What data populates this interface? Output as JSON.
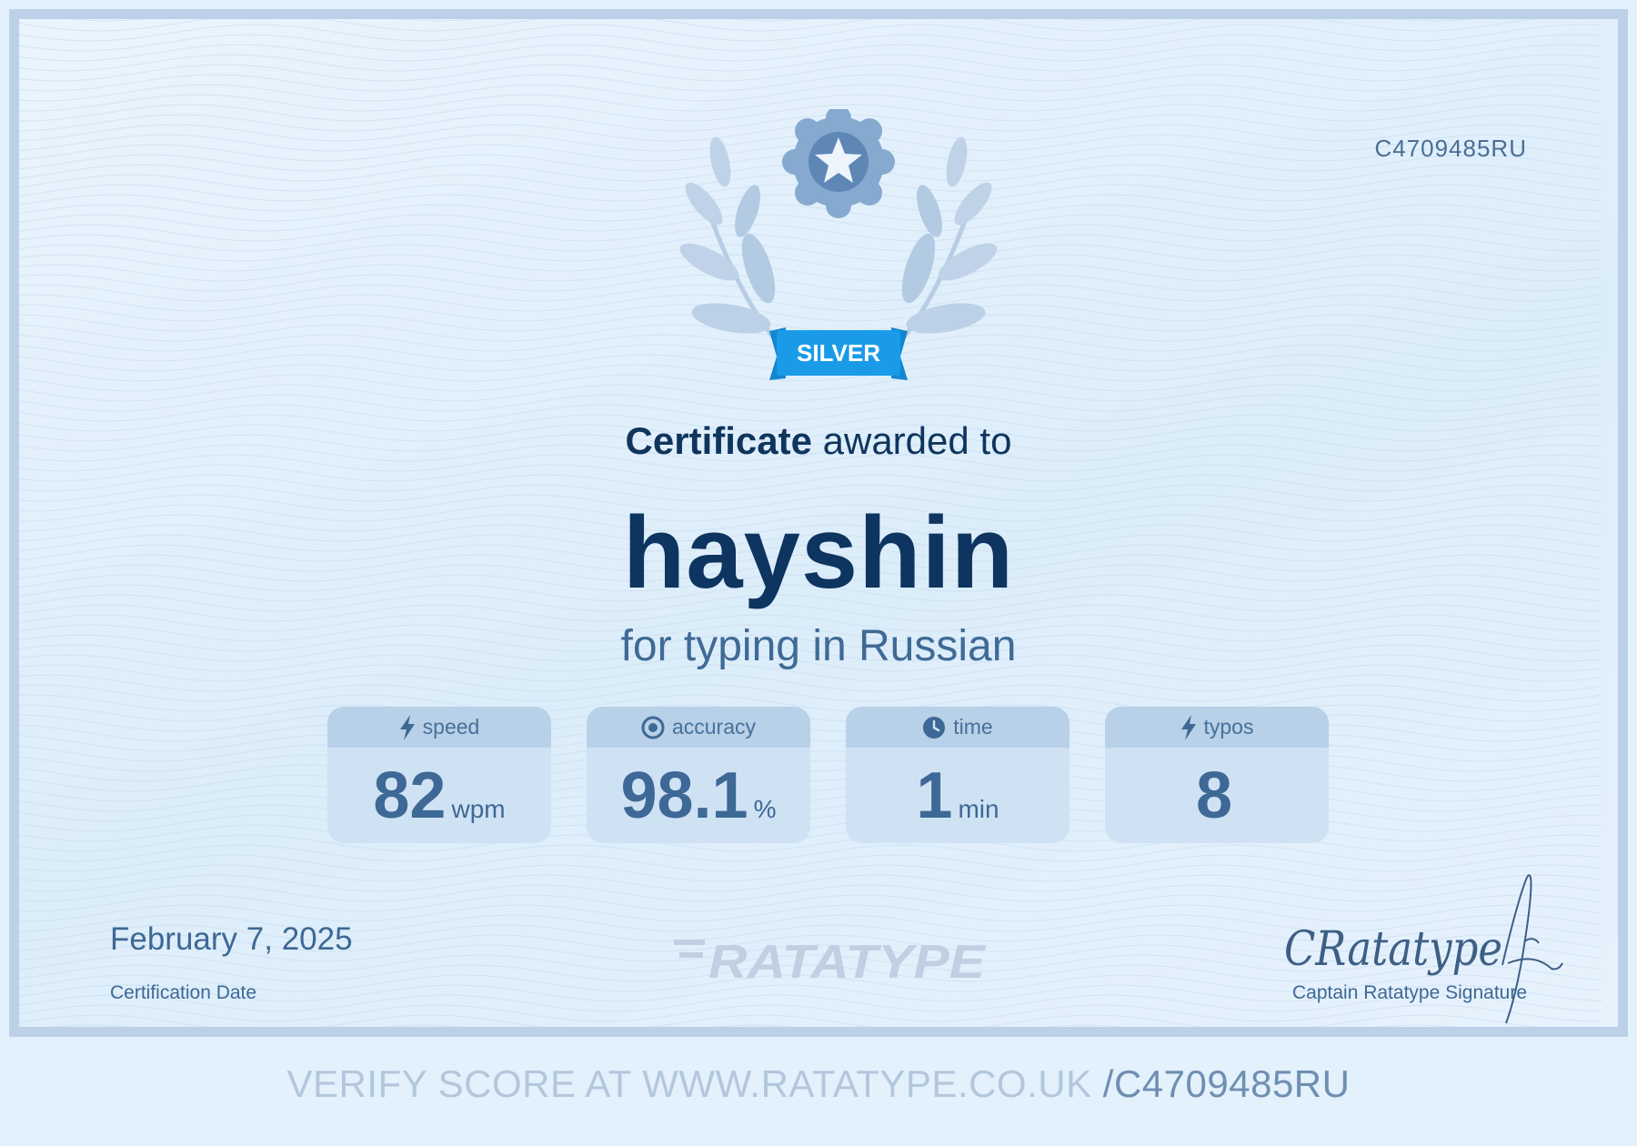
{
  "certificate": {
    "id": "C4709485RU",
    "badge_label": "SILVER",
    "headline_bold": "Certificate",
    "headline_rest": "awarded to",
    "recipient": "hayshin",
    "subtitle": "for typing in Russian"
  },
  "stats": [
    {
      "label": "speed",
      "icon": "lightning-icon",
      "value": "82",
      "unit": "wpm"
    },
    {
      "label": "accuracy",
      "icon": "target-icon",
      "value": "98.1",
      "unit": "%"
    },
    {
      "label": "time",
      "icon": "clock-icon",
      "value": "1",
      "unit": "min"
    },
    {
      "label": "typos",
      "icon": "lightning-icon",
      "value": "8",
      "unit": ""
    }
  ],
  "footer_left": {
    "date": "February 7, 2025",
    "label": "Certification Date"
  },
  "brand": {
    "logo_text": "RATATYPE"
  },
  "signature": {
    "script_text": "CRatatype",
    "label": "Captain Ratatype Signature"
  },
  "verify": {
    "prefix": "VERIFY SCORE AT WWW.RATATYPE.CO.UK",
    "code": "/C4709485RU"
  },
  "colors": {
    "navy_text": "#0e3460",
    "stat_blue": "#3e6895",
    "badge_blue": "#1a9be8",
    "laurel_blue": "#b8cde5",
    "seal_blue": "#86a9cf",
    "border": "#bcd0e8",
    "page_bg": "#e3f1fc"
  }
}
